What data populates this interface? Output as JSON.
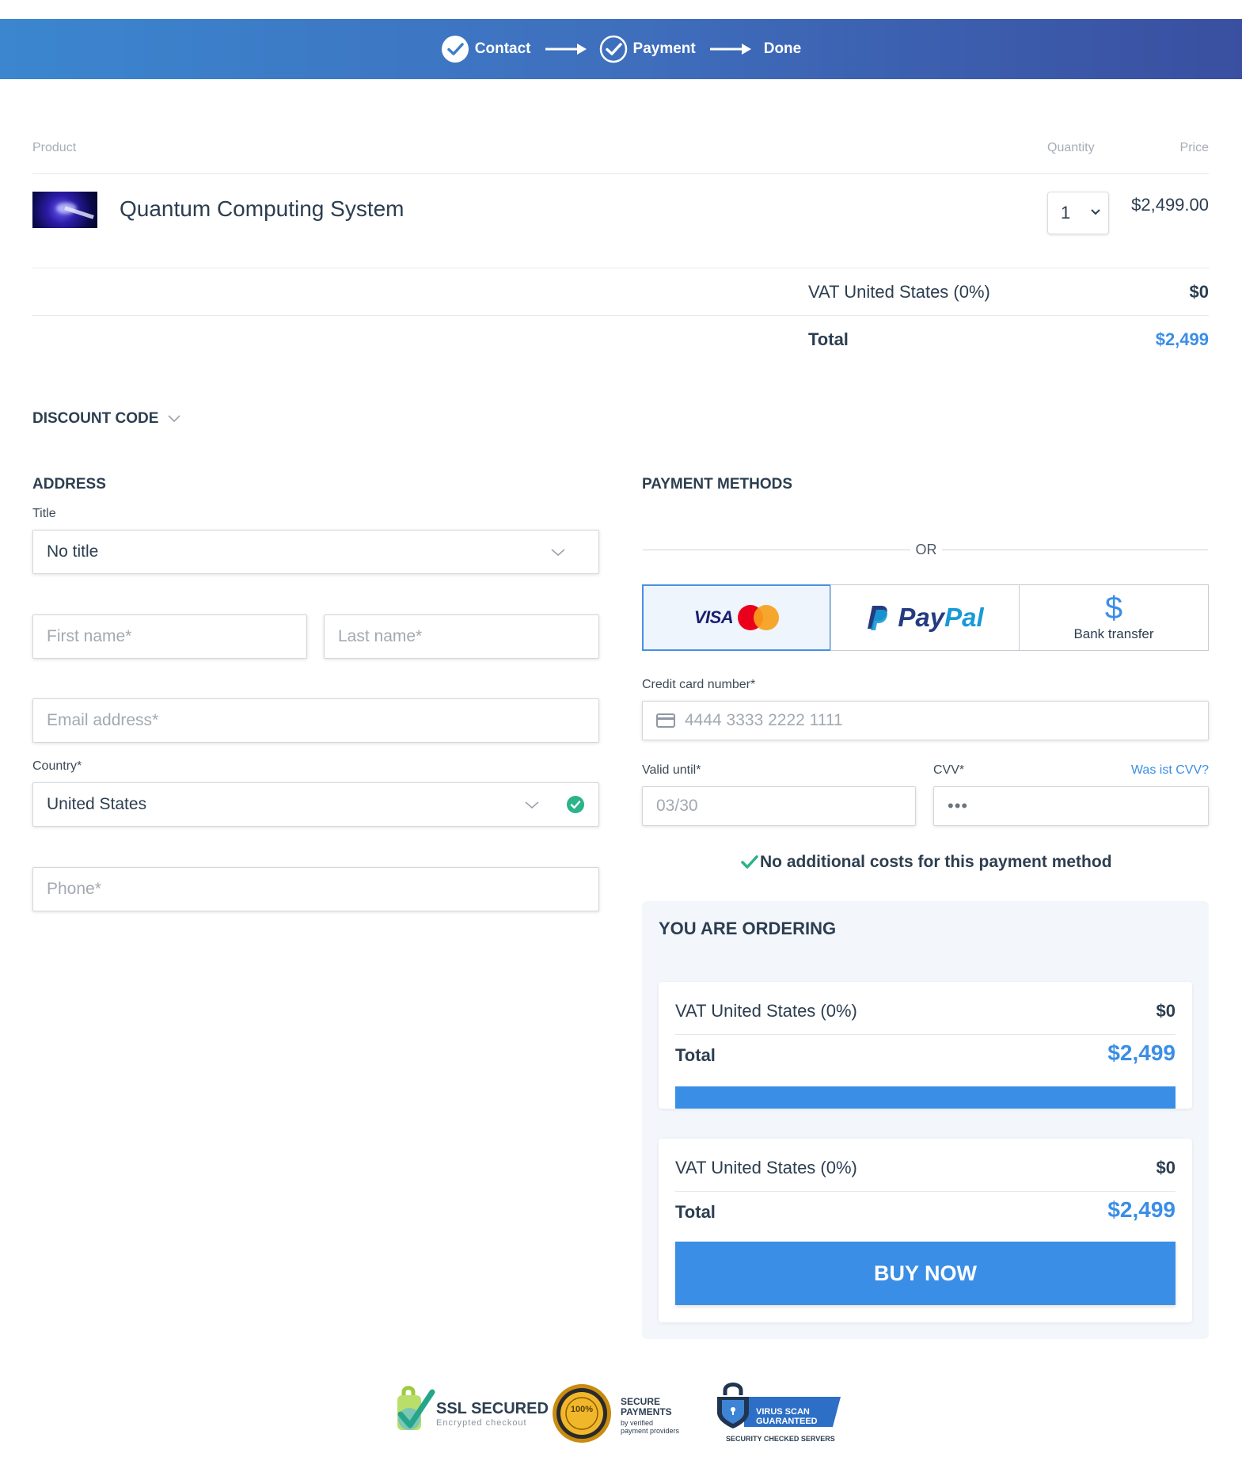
{
  "steps": [
    {
      "label": "Contact",
      "done": true
    },
    {
      "label": "Payment",
      "done": true
    },
    {
      "label": "Done",
      "done": false
    }
  ],
  "cart": {
    "headers": {
      "product": "Product",
      "quantity": "Quantity",
      "price": "Price"
    },
    "item": {
      "name": "Quantum Computing System",
      "quantity": "1",
      "price": "$2,499.00"
    },
    "vat_label": "VAT United States (0%)",
    "vat_value": "$0",
    "total_label": "Total",
    "total_value": "$2,499"
  },
  "discount": {
    "label": "DISCOUNT CODE"
  },
  "address": {
    "title": "ADDRESS",
    "title_label": "Title",
    "title_value": "No title",
    "first_name_placeholder": "First name*",
    "last_name_placeholder": "Last name*",
    "email_placeholder": "Email address*",
    "country_label": "Country*",
    "country_value": "United States",
    "phone_placeholder": "Phone*"
  },
  "payment": {
    "title": "PAYMENT METHODS",
    "or_text": "OR",
    "methods": {
      "visa": "VISA",
      "paypal_pay": "Pay",
      "paypal_pal": "Pal",
      "bank_symbol": "$",
      "bank": "Bank transfer"
    },
    "card_number_label": "Credit card number*",
    "card_number_placeholder": "4444 3333 2222 1111",
    "valid_until_label": "Valid until*",
    "valid_until_placeholder": "03/30",
    "cvv_label": "CVV*",
    "cvv_link": "Was ist CVV?",
    "cvv_placeholder": "•••",
    "no_cost_note": "No additional costs for this payment method"
  },
  "ordering": {
    "title": "YOU ARE ORDERING",
    "vat_label": "VAT United States (0%)",
    "vat_value": "$0",
    "total_label": "Total",
    "total_value": "$2,499",
    "buy_button": "BUY NOW"
  },
  "badges": {
    "ssl_title": "SSL SECURED",
    "ssl_sub": "Encrypted checkout",
    "seal": "100%",
    "secure_title_1": "SECURE",
    "secure_title_2": "PAYMENTS",
    "secure_sub_1": "by verified",
    "secure_sub_2": "payment providers",
    "virus_1": "VIRUS SCAN",
    "virus_2": "GUARANTEED",
    "virus_sub": "SECURITY CHECKED SERVERS"
  },
  "colors": {
    "accent": "#3a8ee6",
    "header_start": "#3b86cf",
    "header_end": "#3a4fa0",
    "success": "#2bb38a",
    "text": "#2c3e50"
  }
}
